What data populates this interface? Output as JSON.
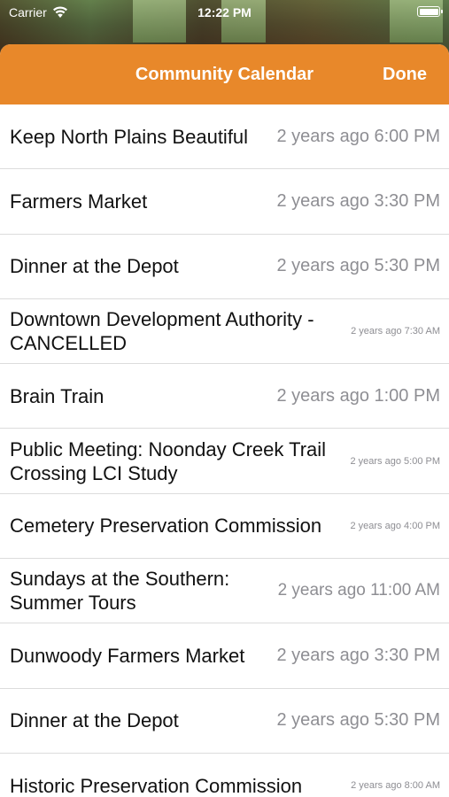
{
  "status_bar": {
    "carrier": "Carrier",
    "time": "12:22 PM"
  },
  "nav": {
    "title": "Community Calendar",
    "done_label": "Done",
    "accent_color": "#e8882a"
  },
  "events": [
    {
      "title": "Keep North Plains Beautiful",
      "time": "2 years ago 6:00 PM"
    },
    {
      "title": "Farmers Market",
      "time": "2 years ago 3:30 PM"
    },
    {
      "title": "Dinner at the Depot",
      "time": "2 years ago 5:30 PM"
    },
    {
      "title": "Downtown Development Authority - CANCELLED",
      "time": "2 years ago 7:30 AM"
    },
    {
      "title": "Brain Train",
      "time": "2 years ago 1:00 PM"
    },
    {
      "title": "Public Meeting: Noonday Creek Trail Crossing LCI Study",
      "time": "2 years ago 5:00 PM"
    },
    {
      "title": "Cemetery Preservation Commission",
      "time": "2 years ago 4:00 PM"
    },
    {
      "title": "Sundays at the Southern: Summer Tours",
      "time": "2 years ago 11:00 AM"
    },
    {
      "title": "Dunwoody Farmers Market",
      "time": "2 years ago 3:30 PM"
    },
    {
      "title": "Dinner at the Depot",
      "time": "2 years ago 5:30 PM"
    },
    {
      "title": "Historic Preservation Commission",
      "time": "2 years ago 8:00 AM"
    }
  ]
}
